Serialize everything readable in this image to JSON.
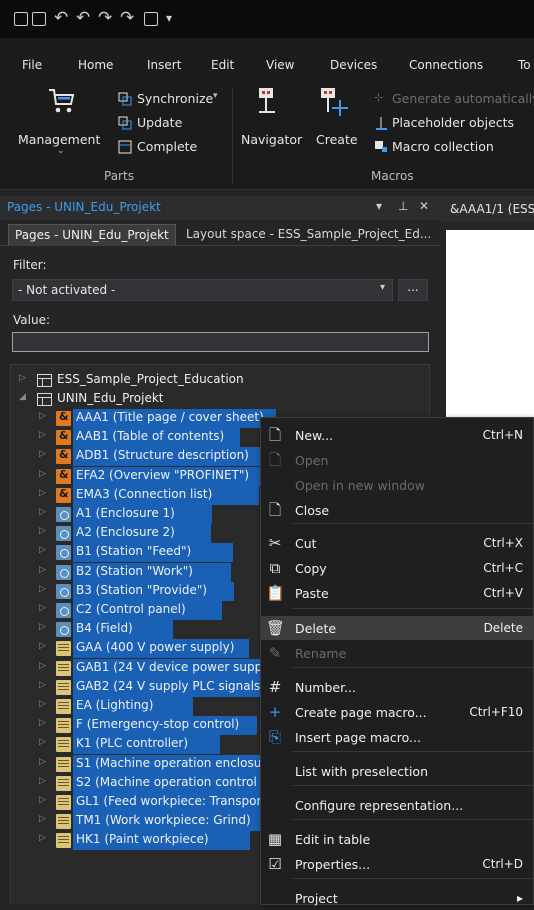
{
  "quick_access": {
    "icons": [
      "new-page-icon",
      "open-page-icon",
      "undo-icon",
      "undo-step-icon",
      "redo-icon",
      "redo-step-icon",
      "format-icon",
      "customize-arrow-icon"
    ]
  },
  "menu": [
    "File",
    "Home",
    "Insert",
    "Edit",
    "View",
    "Devices",
    "Connections",
    "To"
  ],
  "ribbon": {
    "parts": {
      "management": "Management",
      "synchronize": "Synchronize",
      "update": "Update",
      "complete": "Complete",
      "group_label": "Parts"
    },
    "macros": {
      "navigator": "Navigator",
      "create": "Create",
      "generate_automatically": "Generate automatically",
      "placeholder_objects": "Placeholder objects",
      "macro_collection": "Macro collection",
      "group_label": "Macros"
    }
  },
  "panel": {
    "title": "Pages - UNIN_Edu_Projekt",
    "controls": [
      "▾",
      "⊥",
      "✕"
    ],
    "tabs": [
      "Pages - UNIN_Edu_Projekt",
      "Layout space - ESS_Sample_Project_Ed..."
    ],
    "filter_label": "Filter:",
    "filter_value": "- Not activated -",
    "filter_button": "...",
    "value_label": "Value:",
    "value_text": ""
  },
  "document_tab": "&AAA1/1 (ESS",
  "tree": {
    "roots": [
      "ESS_Sample_Project_Education",
      "UNIN_Edu_Projekt"
    ],
    "pages": [
      {
        "label": "AAA1 (Title page / cover sheet)",
        "type": "orange"
      },
      {
        "label": "AAB1 (Table of contents)",
        "type": "orange"
      },
      {
        "label": "ADB1 (Structure description)",
        "type": "orange"
      },
      {
        "label": "EFA2 (Overview \"PROFINET\")",
        "type": "orange"
      },
      {
        "label": "EMA3 (Connection list)",
        "type": "orange"
      },
      {
        "label": "A1 (Enclosure 1)",
        "type": "steel"
      },
      {
        "label": "A2 (Enclosure 2)",
        "type": "steel"
      },
      {
        "label": "B1 (Station \"Feed\")",
        "type": "steel"
      },
      {
        "label": "B2 (Station \"Work\")",
        "type": "steel"
      },
      {
        "label": "B3 (Station \"Provide\")",
        "type": "steel"
      },
      {
        "label": "C2 (Control panel)",
        "type": "steel"
      },
      {
        "label": "B4 (Field)",
        "type": "steel"
      },
      {
        "label": "GAA (400 V power supply)",
        "type": "yellow"
      },
      {
        "label": "GAB1 (24 V device power supp",
        "type": "yellow"
      },
      {
        "label": "GAB2 (24 V supply PLC signals",
        "type": "yellow"
      },
      {
        "label": "EA (Lighting)",
        "type": "yellow"
      },
      {
        "label": "F (Emergency-stop control)",
        "type": "yellow"
      },
      {
        "label": "K1 (PLC controller)",
        "type": "yellow"
      },
      {
        "label": "S1 (Machine operation enclosu",
        "type": "yellow"
      },
      {
        "label": "S2 (Machine operation control",
        "type": "yellow"
      },
      {
        "label": "GL1 (Feed workpiece: Transpor",
        "type": "yellow"
      },
      {
        "label": "TM1 (Work workpiece: Grind)",
        "type": "yellow"
      },
      {
        "label": "HK1 (Paint workpiece)",
        "type": "yellow"
      }
    ]
  },
  "context_menu": {
    "items": [
      {
        "label": "New...",
        "shortcut": "Ctrl+N",
        "icon": "new-page-icon",
        "glyph": "🗋",
        "disabled": false
      },
      {
        "label": "Open",
        "shortcut": "",
        "icon": "open-icon",
        "glyph": "🗋",
        "disabled": true
      },
      {
        "label": "Open in new window",
        "shortcut": "",
        "icon": "",
        "glyph": "",
        "disabled": true
      },
      {
        "label": "Close",
        "shortcut": "",
        "icon": "close-page-icon",
        "glyph": "🗋",
        "disabled": false
      },
      {
        "label": "Cut",
        "shortcut": "Ctrl+X",
        "icon": "scissors-icon",
        "glyph": "✂",
        "disabled": false
      },
      {
        "label": "Copy",
        "shortcut": "Ctrl+C",
        "icon": "copy-icon",
        "glyph": "⧉",
        "disabled": false
      },
      {
        "label": "Paste",
        "shortcut": "Ctrl+V",
        "icon": "paste-icon",
        "glyph": "📋",
        "disabled": false
      },
      {
        "label": "Delete",
        "shortcut": "Delete",
        "icon": "trash-icon",
        "glyph": "🗑",
        "disabled": false,
        "highlight": true
      },
      {
        "label": "Rename",
        "shortcut": "",
        "icon": "rename-icon",
        "glyph": "✎",
        "disabled": true
      },
      {
        "label": "Number...",
        "shortcut": "",
        "icon": "number-icon",
        "glyph": "#",
        "disabled": false
      },
      {
        "label": "Create page macro...",
        "shortcut": "Ctrl+F10",
        "icon": "create-macro-icon",
        "glyph": "+",
        "disabled": false
      },
      {
        "label": "Insert page macro...",
        "shortcut": "",
        "icon": "insert-macro-icon",
        "glyph": "⎘",
        "disabled": false
      },
      {
        "label": "List with preselection",
        "shortcut": "",
        "icon": "",
        "glyph": "",
        "disabled": false
      },
      {
        "label": "Configure representation...",
        "shortcut": "",
        "icon": "",
        "glyph": "",
        "disabled": false
      },
      {
        "label": "Edit in table",
        "shortcut": "",
        "icon": "table-icon",
        "glyph": "▦",
        "disabled": false
      },
      {
        "label": "Properties...",
        "shortcut": "Ctrl+D",
        "icon": "properties-icon",
        "glyph": "☑",
        "disabled": false
      },
      {
        "label": "Project",
        "shortcut": "▸",
        "icon": "",
        "glyph": "",
        "disabled": false
      }
    ]
  },
  "colors": {
    "selection": "#1a61b5",
    "panel_title": "#3e9bf0",
    "orange_page": "#e07a20",
    "steel_page": "#5a8fc0",
    "yellow_page": "#dcc47a"
  }
}
